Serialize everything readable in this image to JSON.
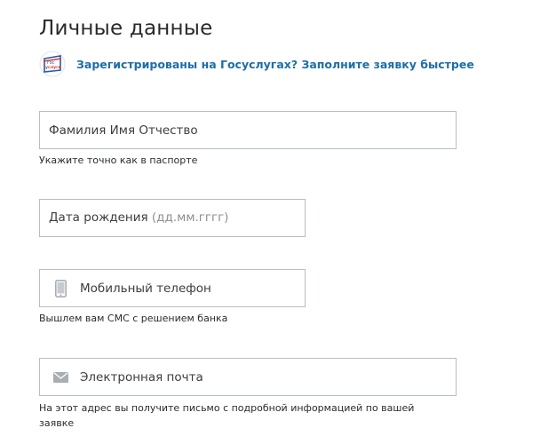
{
  "page": {
    "title": "Личные данные"
  },
  "gosuslugi": {
    "logo_text_top": "гос",
    "logo_text_bottom": "услуги",
    "link_text": "Зарегистрированы на Госуслугах? Заполните заявку быстрее",
    "icon": "gosuslugi-logo"
  },
  "fields": {
    "full_name": {
      "placeholder": "Фамилия Имя Отчество",
      "value": "",
      "help": "Укажите точно как в паспорте"
    },
    "birth_date": {
      "label": "Дата рождения",
      "format_hint": "(дд.мм.гггг)",
      "value": ""
    },
    "phone": {
      "placeholder": "Мобильный телефон",
      "value": "",
      "icon": "phone-icon",
      "help": "Вышлем вам СМС с решением банка"
    },
    "email": {
      "placeholder": "Электронная почта",
      "value": "",
      "icon": "envelope-icon",
      "help": "На этот адрес вы получите письмо с подробной информацией по вашей заявке"
    }
  },
  "colors": {
    "link": "#1f6ea7",
    "border": "#b9bec3",
    "icon": "#a9aeb3",
    "logo_red": "#d8323a",
    "logo_blue": "#1f5fa6"
  }
}
